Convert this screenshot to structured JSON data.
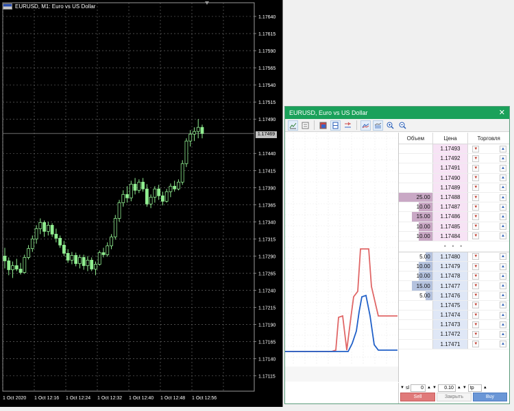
{
  "chart": {
    "title": "EURUSD, M1:  Euro vs US Dollar",
    "price_axis": [
      "1.17640",
      "1.17615",
      "1.17590",
      "1.17565",
      "1.17540",
      "1.17515",
      "1.17490",
      "1.17440",
      "1.17415",
      "1.17390",
      "1.17365",
      "1.17340",
      "1.17315",
      "1.17290",
      "1.17265",
      "1.17240",
      "1.17215",
      "1.17190",
      "1.17165",
      "1.17140",
      "1.17115"
    ],
    "current_price": "1.17469",
    "time_axis": [
      "1 Oct 2020",
      "1 Oct 12:16",
      "1 Oct 12:24",
      "1 Oct 12:32",
      "1 Oct 12:40",
      "1 Oct 12:48",
      "1 Oct 12:56"
    ],
    "candle_up_color": "#90ee90",
    "grid_color": "#7a7a7a"
  },
  "dom": {
    "title": "EURUSD, Euro vs US Dollar",
    "close_symbol": "✕",
    "toolbar_icons": [
      "chart-icon",
      "list-icon",
      "color-icon",
      "split-icon",
      "layout-icon",
      "curve-icon",
      "fill-icon",
      "zoom-in-icon",
      "zoom-out-icon"
    ],
    "headers": {
      "volume": "Объем",
      "price": "Цена",
      "trade": "Торговля"
    },
    "asks": [
      {
        "vol": "",
        "price": "1.17493"
      },
      {
        "vol": "",
        "price": "1.17492"
      },
      {
        "vol": "",
        "price": "1.17491"
      },
      {
        "vol": "",
        "price": "1.17490"
      },
      {
        "vol": "",
        "price": "1.17489"
      },
      {
        "vol": "25.00",
        "price": "1.17488"
      },
      {
        "vol": "10.00",
        "price": "1.17487"
      },
      {
        "vol": "15.00",
        "price": "1.17486"
      },
      {
        "vol": "10.00",
        "price": "1.17485"
      },
      {
        "vol": "10.00",
        "price": "1.17484"
      }
    ],
    "separator": "• • •",
    "bids": [
      {
        "vol": "5.00",
        "price": "1.17480"
      },
      {
        "vol": "10.00",
        "price": "1.17479"
      },
      {
        "vol": "10.00",
        "price": "1.17478"
      },
      {
        "vol": "15.00",
        "price": "1.17477"
      },
      {
        "vol": "5.00",
        "price": "1.17476"
      },
      {
        "vol": "",
        "price": "1.17475"
      },
      {
        "vol": "",
        "price": "1.17474"
      },
      {
        "vol": "",
        "price": "1.17473"
      },
      {
        "vol": "",
        "price": "1.17472"
      },
      {
        "vol": "",
        "price": "1.17471"
      }
    ],
    "controls": {
      "sl_label": "sl",
      "sl_value": "0",
      "lot_value": "0.10",
      "tp_label": "tp"
    },
    "buttons": {
      "sell": "Sell",
      "close": "Закрыть",
      "buy": "Buy"
    },
    "ask_color": "#e06666",
    "bid_color": "#1f5fc8"
  }
}
